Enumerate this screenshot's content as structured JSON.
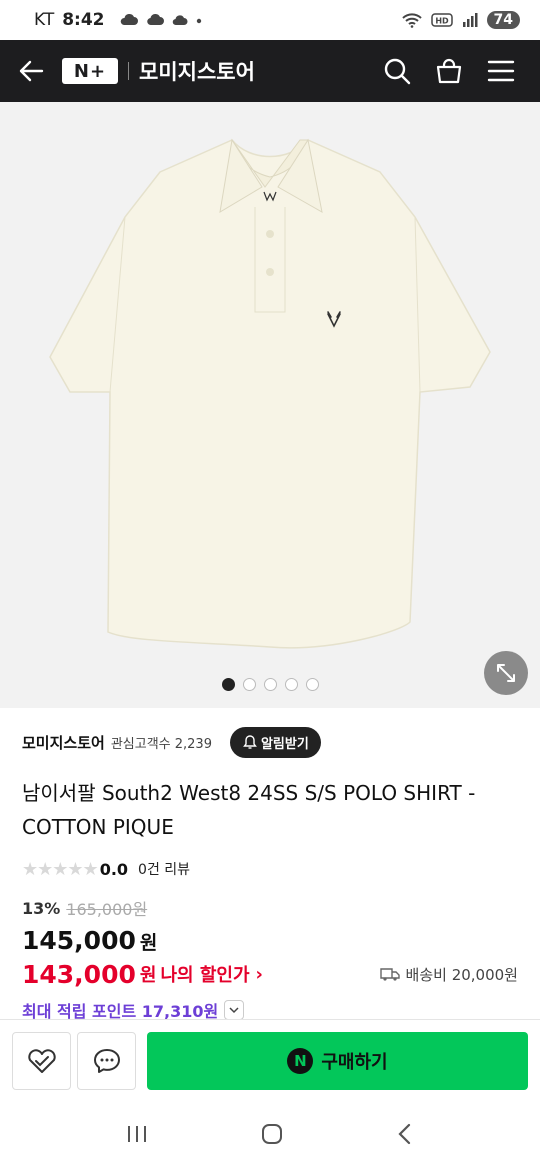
{
  "status_bar": {
    "carrier": "KT",
    "time": "8:42",
    "battery": "74"
  },
  "header": {
    "brand": "N+",
    "store_name": "모미지스토어"
  },
  "gallery": {
    "image_count": 5,
    "active_index": 0
  },
  "store": {
    "name": "모미지스토어",
    "fans": "관심고객수 2,239",
    "alarm_label": "알림받기"
  },
  "product": {
    "title": "남이서팔 South2 West8 24SS S/S POLO SHIRT - COTTON PIQUE",
    "stars": "★★★★★",
    "rating": "0.0",
    "reviews": "0건 리뷰",
    "discount_pct": "13%",
    "original_price": "165,000원",
    "price": "145,000",
    "price_unit": "원",
    "my_price": "143,000",
    "my_price_unit": "원",
    "my_price_label": "나의 할인가",
    "shipping": "배송비 20,000원",
    "points": "최대 적립 포인트 17,310원"
  },
  "bottom_bar": {
    "buy_label": "구매하기",
    "buy_badge": "N"
  },
  "colors": {
    "accent_green": "#03c75a",
    "discount_red": "#e4002b",
    "points_purple": "#6d3fd6",
    "header_bg": "#1d1d1f"
  }
}
